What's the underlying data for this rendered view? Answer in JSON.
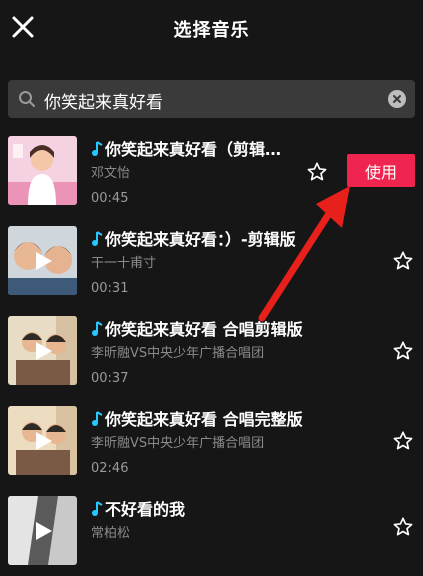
{
  "header": {
    "title": "选择音乐",
    "close_icon": "close-icon"
  },
  "search": {
    "value": "你笑起来真好看",
    "icon": "search-icon",
    "clear_icon": "clear-icon"
  },
  "songs": [
    {
      "title": "你笑起来真好看（剪辑…",
      "artist": "邓文怡",
      "duration": "00:45",
      "use_label": "使用"
    },
    {
      "title": "你笑起来真好看：）-剪辑版",
      "artist": "干一十甫寸",
      "duration": "00:31"
    },
    {
      "title": "你笑起来真好看 合唱剪辑版",
      "artist": "李昕融VS中央少年广播合唱团",
      "duration": "00:37"
    },
    {
      "title": "你笑起来真好看 合唱完整版",
      "artist": "李昕融VS中央少年广播合唱团",
      "duration": "02:46"
    },
    {
      "title": "不好看的我",
      "artist": "常柏松",
      "duration": ""
    }
  ],
  "colors": {
    "accent": "#f0254f",
    "background": "#161616",
    "search_bg": "#3a3a3a",
    "arrow": "#e8201c"
  }
}
